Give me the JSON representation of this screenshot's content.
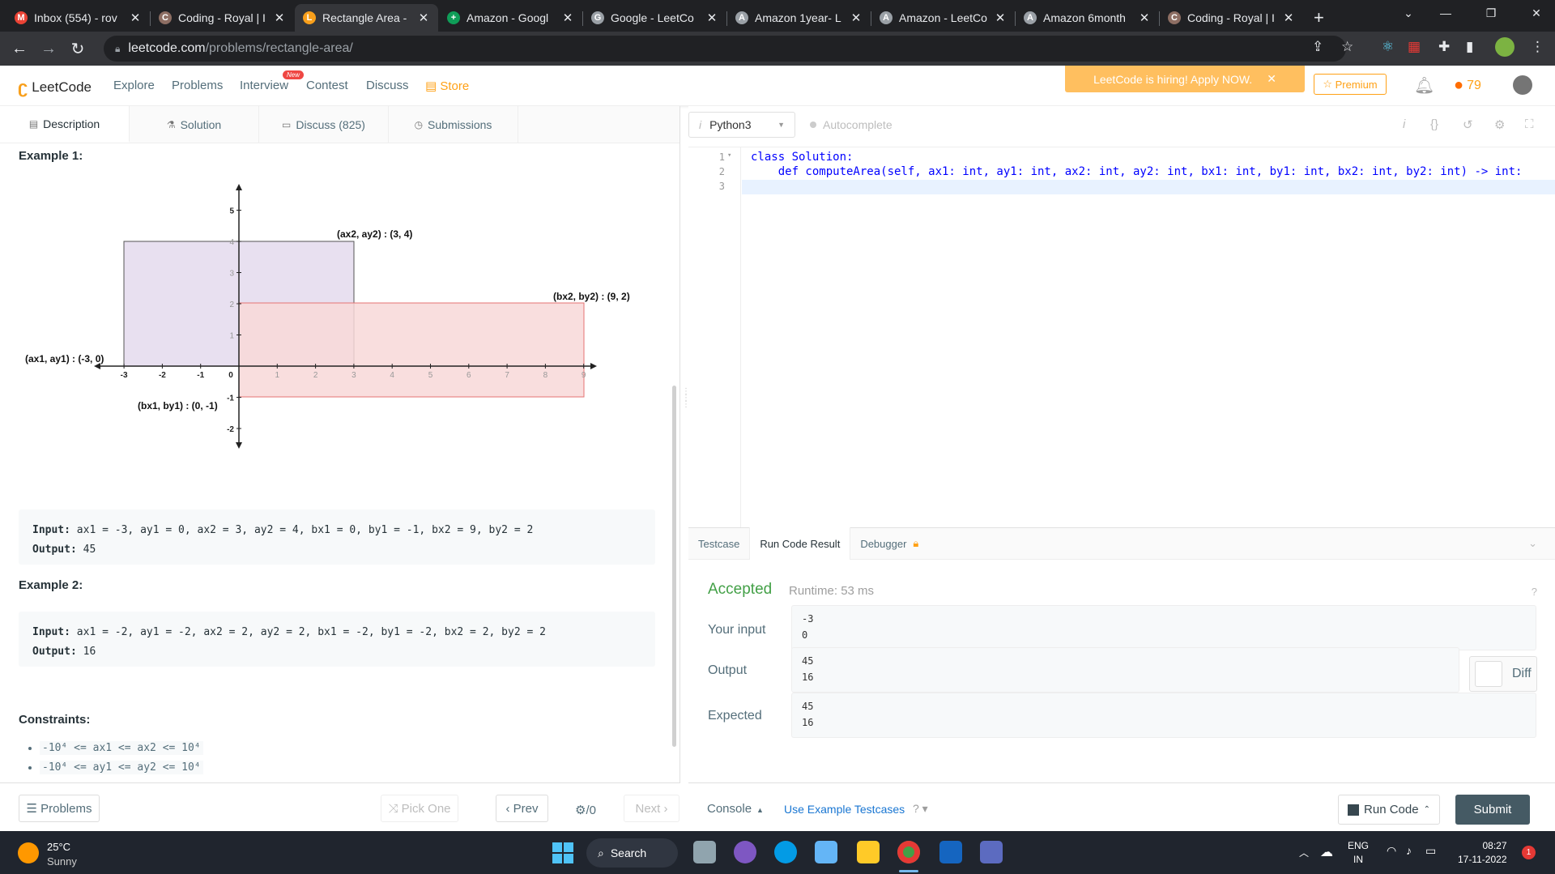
{
  "browser": {
    "tabs": [
      {
        "title": "Inbox (554) - rov",
        "color": "#ea4335",
        "glyph": "M"
      },
      {
        "title": "Coding - Royal | I",
        "color": "#8d6e63",
        "glyph": "C"
      },
      {
        "title": "Rectangle Area -",
        "color": "#f89f1b",
        "glyph": "L",
        "active": true
      },
      {
        "title": "Amazon - Googl",
        "color": "#0f9d58",
        "glyph": "+"
      },
      {
        "title": "Google - LeetCo",
        "color": "#9aa0a6",
        "glyph": "G"
      },
      {
        "title": "Amazon 1year- L",
        "color": "#9aa0a6",
        "glyph": "A"
      },
      {
        "title": "Amazon - LeetCo",
        "color": "#9aa0a6",
        "glyph": "A"
      },
      {
        "title": "Amazon 6month",
        "color": "#9aa0a6",
        "glyph": "A"
      },
      {
        "title": "Coding - Royal | I",
        "color": "#8d6e63",
        "glyph": "C"
      }
    ],
    "url_host": "leetcode.com",
    "url_path": "/problems/rectangle-area/",
    "new_tab": "+"
  },
  "nav": {
    "logo": "LeetCode",
    "links": [
      "Explore",
      "Problems",
      "Interview",
      "Contest",
      "Discuss",
      "Store"
    ],
    "new_badge": "New",
    "hiring": "LeetCode is hiring! Apply NOW.",
    "premium": "Premium",
    "streak": "79"
  },
  "desc_tabs": [
    "Description",
    "Solution",
    "Discuss (825)",
    "Submissions"
  ],
  "description": {
    "example1_title": "Example 1:",
    "example1_input": "ax1 = -3, ay1 = 0, ax2 = 3, ay2 = 4, bx1 = 0, by1 = -1, bx2 = 9, by2 = 2",
    "example1_output": "45",
    "example2_title": "Example 2:",
    "example2_input": "ax1 = -2, ay1 = -2, ax2 = 2, ay2 = 2, bx1 = -2, by1 = -2, bx2 = 2, by2 = 2",
    "example2_output": "16",
    "input_label": "Input:",
    "output_label": "Output:",
    "constraints_title": "Constraints:",
    "constraints": [
      "-10⁴ <= ax1 <= ax2 <= 10⁴",
      "-10⁴ <= ay1 <= ay2 <= 10⁴"
    ]
  },
  "diagram": {
    "label_a2": "(ax2, ay2) : (3, 4)",
    "label_b2": "(bx2, by2) : (9, 2)",
    "label_a1": "(ax1, ay1) : (-3, 0)",
    "label_b1": "(bx1, by1) : (0, -1)",
    "x_ticks": [
      "-3",
      "-2",
      "-1",
      "0",
      "1",
      "2",
      "3",
      "4",
      "5",
      "6",
      "7",
      "8",
      "9"
    ],
    "y_ticks": [
      "5",
      "4",
      "3",
      "2",
      "1",
      "-1",
      "-2"
    ],
    "rect_a_color": "#e8e0f0",
    "rect_b_color": "#f8d8d8"
  },
  "leftbar": {
    "problems": "Problems",
    "pick_one": "Pick One",
    "prev": "Prev",
    "counter": "/0",
    "next": "Next"
  },
  "editor": {
    "language": "Python3",
    "autocomplete": "Autocomplete",
    "line_numbers": [
      "1",
      "2",
      "3"
    ],
    "line1": "class Solution:",
    "line2": "    def computeArea(self, ax1: int, ay1: int, ax2: int, ay2: int, bx1: int, by1: int, bx2: int, by2: int) -> int:"
  },
  "result_tabs": [
    "Testcase",
    "Run Code Result",
    "Debugger"
  ],
  "result": {
    "status": "Accepted",
    "runtime": "Runtime: 53 ms",
    "your_input_label": "Your input",
    "your_input": "-3\n0",
    "output_label": "Output",
    "output": "45\n16",
    "expected_label": "Expected",
    "expected": "45\n16",
    "diff": "Diff"
  },
  "rightbar": {
    "console": "Console",
    "use_example": "Use Example Testcases",
    "run_code": "Run Code",
    "submit": "Submit"
  },
  "taskbar": {
    "temp": "25°C",
    "weather": "Sunny",
    "search": "Search",
    "lang1": "ENG",
    "lang2": "IN",
    "time": "08:27",
    "date": "17-11-2022",
    "notif": "1"
  }
}
